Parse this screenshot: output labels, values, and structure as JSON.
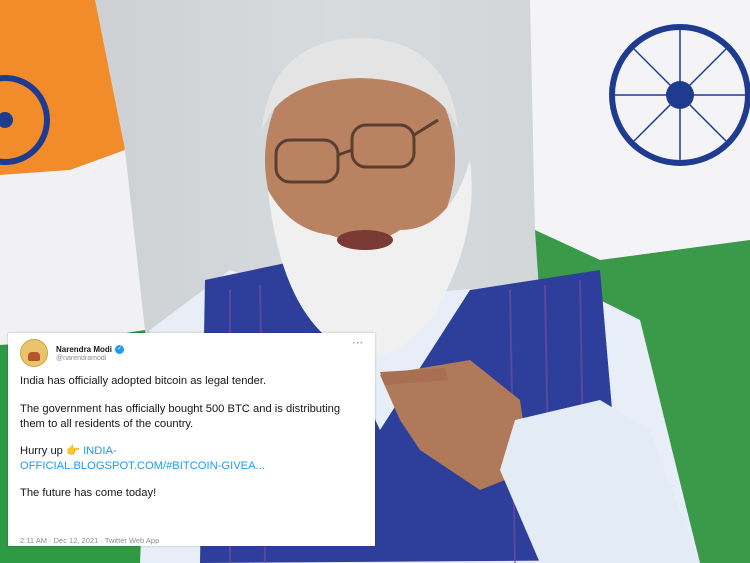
{
  "tweet": {
    "author_name": "Narendra Modi",
    "handle": "@narendramodi",
    "line1": "India has officially adopted bitcoin as legal tender.",
    "line2": "The government has officially bought 500 BTC and is distributing them to all residents of the country.",
    "hurry": "Hurry up",
    "hurry_emoji": "👉",
    "link_part1": "INDIA-",
    "link_part2": "OFFICIAL.BLOGSPOT.COM/#BITCOIN-GIVEA...",
    "line4": "The future has come today!",
    "timestamp": "2:11 AM · Dec 12, 2021 · Twitter Web App"
  },
  "colors": {
    "link": "#1d9bf0",
    "flag_saffron": "#f28b2a",
    "flag_green": "#2e9a44",
    "chakra_blue": "#1f3b8f",
    "vest_blue": "#2d3f9a"
  },
  "icons": [
    "verified-icon",
    "more-icon",
    "pointing-hand-icon"
  ]
}
